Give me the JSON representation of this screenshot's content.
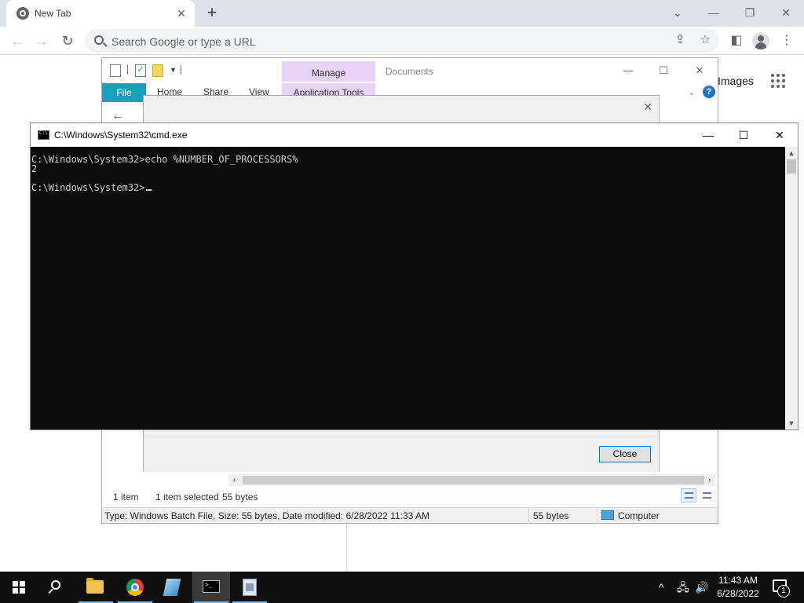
{
  "chrome": {
    "tab_title": "New Tab",
    "tab_close": "✕",
    "new_tab": "+",
    "omnibox_placeholder": "Search Google or type a URL",
    "page_images_link": "Images",
    "window_controls": {
      "dropdown": "⌄",
      "minimize": "—",
      "restore": "❐",
      "close": "✕"
    }
  },
  "explorer": {
    "title": "Documents",
    "manage_tab": "Manage",
    "ribbon_tabs": {
      "file": "File",
      "home": "Home",
      "share": "Share",
      "view": "View",
      "application_tools": "Application Tools"
    },
    "status": {
      "item_count": "1 item",
      "selected": "1 item selected",
      "size": "55 bytes"
    },
    "details": {
      "summary": "Type: Windows Batch File, Size: 55 bytes, Date modified: 6/28/2022 11:33 AM",
      "size": "55 bytes",
      "location": "Computer"
    }
  },
  "properties_dialog": {
    "close_label": "Close"
  },
  "cmd": {
    "title": "C:\\Windows\\System32\\cmd.exe",
    "lines": [
      "C:\\Windows\\System32>echo %NUMBER_OF_PROCESSORS%",
      "2",
      "",
      "C:\\Windows\\System32>"
    ]
  },
  "taskbar": {
    "clock_time": "11:43 AM",
    "clock_date": "6/28/2022",
    "notification_count": "1",
    "apps": [
      "file-explorer-icon",
      "chrome-icon",
      "notepad-icon",
      "cmd-icon",
      "batch-file-icon"
    ]
  }
}
